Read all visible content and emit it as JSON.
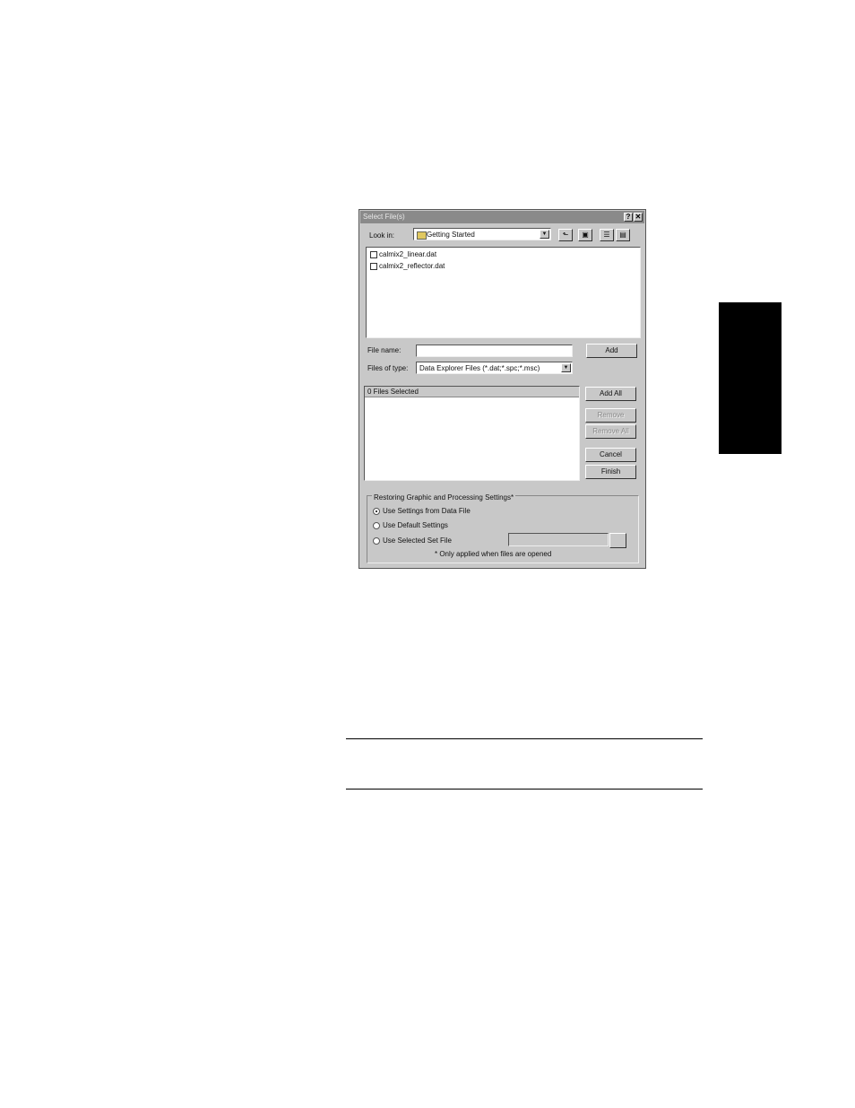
{
  "dialog": {
    "title": "Select File(s)",
    "help_btn": "?",
    "close_btn": "✕",
    "look_in_label": "Look in:",
    "look_in_value": "Getting Started",
    "files": [
      "calmix2_linear.dat",
      "calmix2_reflector.dat"
    ],
    "file_name_label": "File name:",
    "file_name_value": "",
    "files_of_type_label": "Files of type:",
    "files_of_type_value": "Data Explorer Files (*.dat;*.spc;*.msc)",
    "selected_header": "0 Files Selected",
    "buttons": {
      "add": "Add",
      "add_all": "Add All",
      "remove": "Remove",
      "remove_all": "Remove All",
      "cancel": "Cancel",
      "finish": "Finish",
      "browse": ""
    },
    "settings": {
      "legend": "Restoring Graphic and Processing Settings*",
      "options": [
        "Use Settings from Data File",
        "Use Default Settings",
        "Use Selected Set File"
      ],
      "selected_index": 0,
      "set_file_value": "",
      "note": "* Only applied when files are opened"
    }
  }
}
